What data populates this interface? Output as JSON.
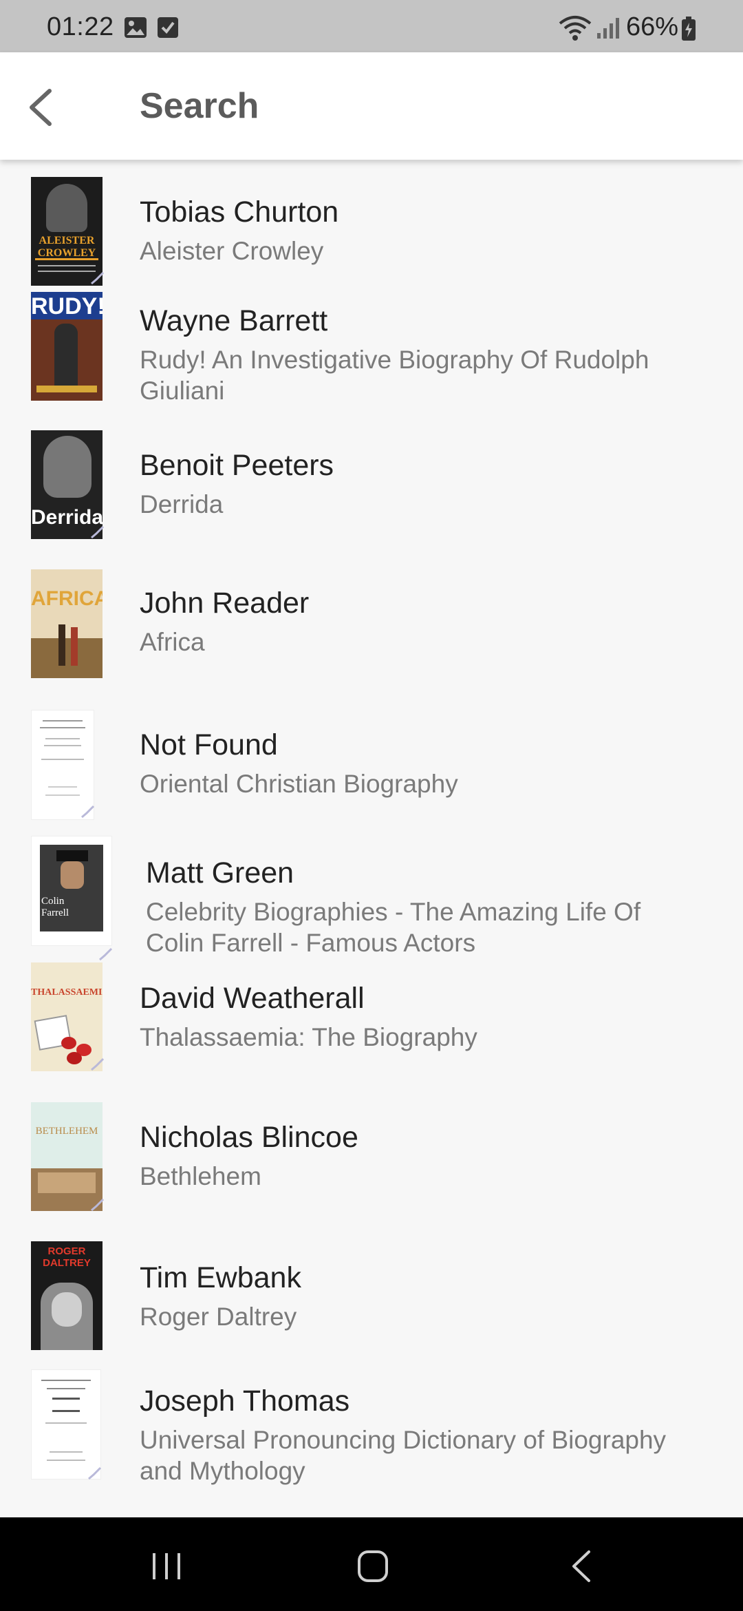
{
  "status_bar": {
    "time": "01:22",
    "battery": "66%",
    "icons": [
      "gallery-icon",
      "checkbox-icon",
      "wifi-icon",
      "signal-icon",
      "battery-icon"
    ]
  },
  "app_bar": {
    "title": "Search",
    "back_icon": "chevron-left-icon"
  },
  "results": [
    {
      "author": "Tobias Churton",
      "title": "Aleister Crowley",
      "cover_text": "ALEISTER CROWLEY"
    },
    {
      "author": "Wayne Barrett",
      "title": "Rudy! An Investigative Biography Of Rudolph Giuliani",
      "cover_text": "RUDY!"
    },
    {
      "author": "Benoit Peeters",
      "title": "Derrida",
      "cover_text": "Derrida"
    },
    {
      "author": "John Reader",
      "title": "Africa",
      "cover_text": "AFRICA"
    },
    {
      "author": "Not Found",
      "title": "Oriental Christian Biography",
      "cover_text": ""
    },
    {
      "author": "Matt Green",
      "title": "Celebrity Biographies - The Amazing Life Of Colin Farrell - Famous Actors",
      "cover_text": "Colin Farrell"
    },
    {
      "author": "David Weatherall",
      "title": "Thalassaemia: The Biography",
      "cover_text": "THALASSAEMIA"
    },
    {
      "author": "Nicholas Blincoe",
      "title": "Bethlehem",
      "cover_text": "BETHLEHEM"
    },
    {
      "author": "Tim Ewbank",
      "title": "Roger Daltrey",
      "cover_text": "ROGER DALTREY"
    },
    {
      "author": "Joseph Thomas",
      "title": "Universal Pronouncing Dictionary of Biography and Mythology",
      "cover_text": ""
    }
  ],
  "nav_bar": {
    "buttons": [
      "recent-apps-icon",
      "home-icon",
      "back-icon"
    ]
  }
}
